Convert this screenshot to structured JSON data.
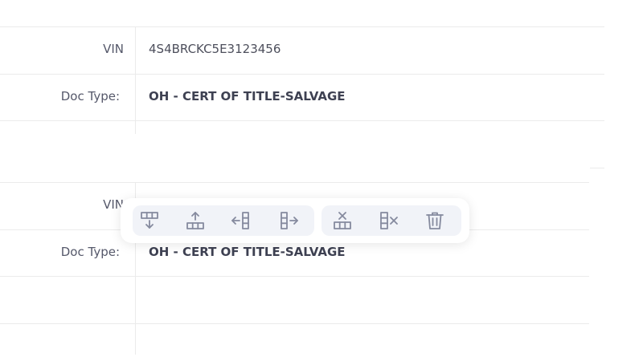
{
  "section1": {
    "vin_label": "VIN",
    "vin_value": "4S4BRCKC5E3123456",
    "doc_type_label": "Doc Type:",
    "doc_type_value": "OH - CERT OF TITLE-SALVAGE"
  },
  "section2": {
    "vin_label": "VIN",
    "doc_type_label": "Doc Type:",
    "doc_type_value": "OH - CERT OF TITLE-SALVAGE"
  },
  "toolbar": {
    "group1": [
      {
        "icon": "insert-row-below-icon"
      },
      {
        "icon": "insert-row-above-icon"
      },
      {
        "icon": "insert-column-left-icon"
      },
      {
        "icon": "insert-column-right-icon"
      }
    ],
    "group2": [
      {
        "icon": "delete-row-icon"
      },
      {
        "icon": "delete-column-icon"
      },
      {
        "icon": "trash-icon"
      }
    ],
    "icon_color": "#858a9e"
  }
}
